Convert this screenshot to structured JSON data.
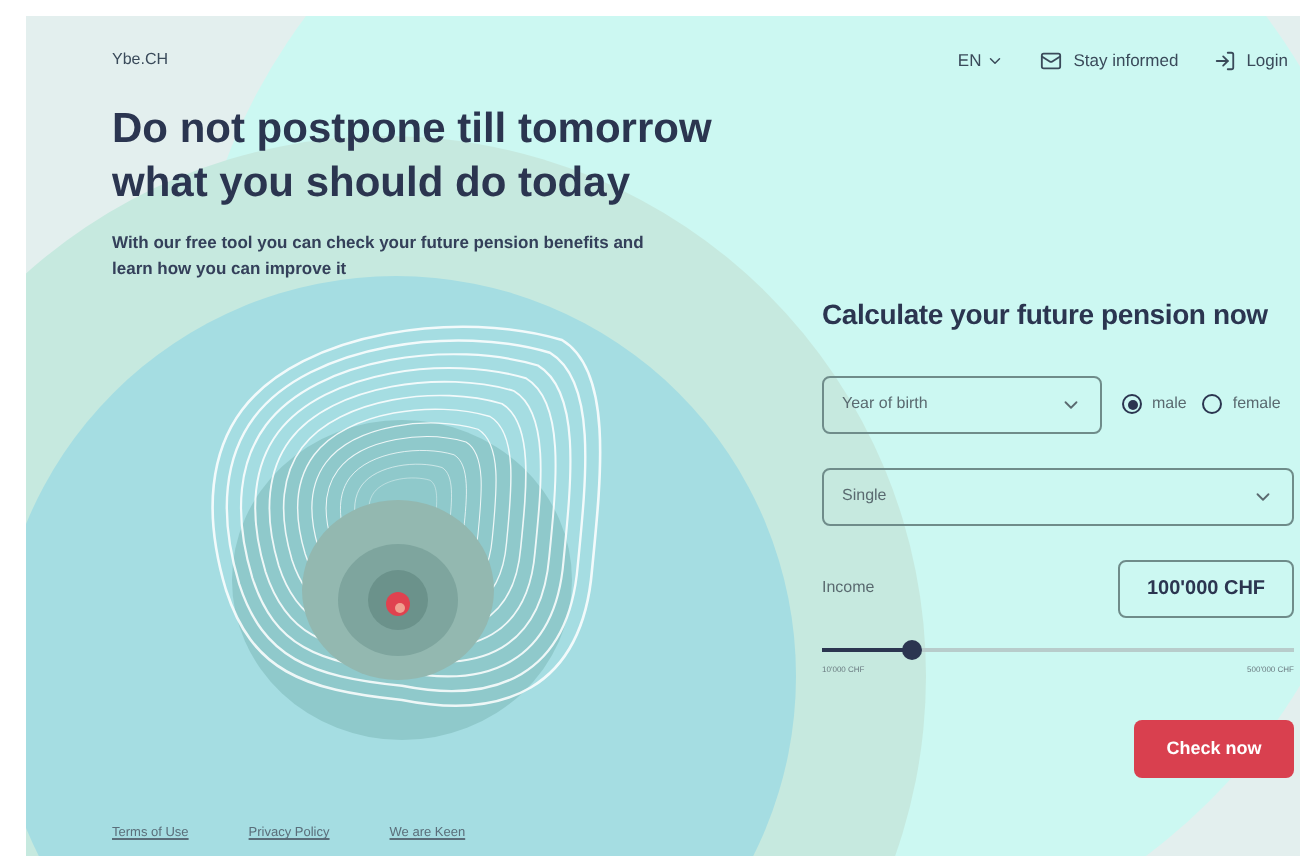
{
  "header": {
    "logo": "Ybe.CH",
    "language": "EN",
    "stay_informed": "Stay informed",
    "login": "Login"
  },
  "hero": {
    "title_line_1": "Do not postpone till tomorrow",
    "title_line_2": "what you should do today",
    "subtitle": "With our free tool you can check your future pension benefits and learn how you can improve it"
  },
  "calculator": {
    "title": "Calculate your future pension now",
    "year_of_birth": {
      "placeholder": "Year of birth"
    },
    "gender": [
      {
        "label": "male",
        "selected": true
      },
      {
        "label": "female",
        "selected": false
      }
    ],
    "civil_status": {
      "value": "Single"
    },
    "income": {
      "label": "Income",
      "value": "100'000 CHF",
      "level": 0.19,
      "min_label": "10'000 CHF",
      "max_label": "500'000 CHF"
    },
    "button": "Check now"
  },
  "footer": {
    "links": [
      "Terms of Use",
      "Privacy Policy",
      "We are Keen"
    ]
  }
}
